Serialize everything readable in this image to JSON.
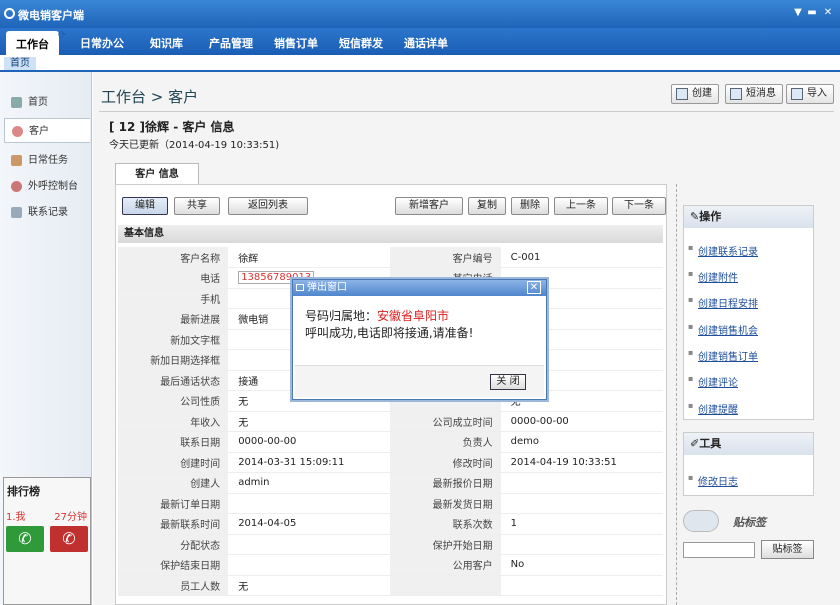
{
  "app": {
    "title": "微电销客户端"
  },
  "menu": {
    "items": [
      "工作台",
      "日常办公",
      "知识库",
      "产品管理",
      "销售订单",
      "短信群发",
      "通话详单"
    ]
  },
  "crumb": {
    "home": "首页"
  },
  "sidebar": {
    "items": [
      "首页",
      "客户",
      "日常任务",
      "外呼控制台",
      "联系记录"
    ]
  },
  "rank": {
    "title": "排行榜",
    "name": "1.我",
    "value": "27分钟"
  },
  "page": {
    "title": "工作台  > 客户",
    "record_title": "[ 12 ]徐辉  - 客户  信息",
    "updated": "今天已更新（2014-04-19 10:33:51)",
    "tab": "客户  信息",
    "section": "基本信息"
  },
  "toolbar": {
    "create": "创建",
    "sms": "短消息",
    "import": "导入"
  },
  "actions": [
    "编辑",
    "共享",
    "返回列表",
    "新增客户",
    "复制",
    "删除",
    "上一条",
    "下一条"
  ],
  "fields": [
    [
      "客户名称",
      "徐辉",
      "客户编号",
      "C-001"
    ],
    [
      "电话",
      "13856789013",
      "其它电话",
      ""
    ],
    [
      "手机",
      "",
      "",
      ""
    ],
    [
      "最新进展",
      "微电销",
      "",
      ""
    ],
    [
      "新加文字框",
      "",
      "",
      ""
    ],
    [
      "新加日期选择框",
      "",
      "",
      ""
    ],
    [
      "最后通话状态",
      "接通",
      "",
      ""
    ],
    [
      "公司性质",
      "无",
      "",
      "无"
    ],
    [
      "年收入",
      "无",
      "公司成立时间",
      "0000-00-00"
    ],
    [
      "联系日期",
      "0000-00-00",
      "负责人",
      "demo"
    ],
    [
      "创建时间",
      "2014-03-31 15:09:11",
      "修改时间",
      "2014-04-19 10:33:51"
    ],
    [
      "创建人",
      "admin",
      "最新报价日期",
      ""
    ],
    [
      "最新订单日期",
      "",
      "最新发货日期",
      ""
    ],
    [
      "最新联系时间",
      "2014-04-05",
      "联系次数",
      "1"
    ],
    [
      "分配状态",
      "",
      "保护开始日期",
      ""
    ],
    [
      "保护结束日期",
      "",
      "公用客户",
      "No"
    ],
    [
      "员工人数",
      "无",
      "",
      ""
    ]
  ],
  "ops": {
    "title": "操作",
    "links": [
      "创建联系记录",
      "创建附件",
      "创建日程安排",
      "创建销售机会",
      "创建销售订单",
      "创建评论",
      "创建提醒"
    ]
  },
  "tools": {
    "title": "工具",
    "links": [
      "修改日志"
    ]
  },
  "sticky": {
    "title": "贴标签",
    "button": "贴标签"
  },
  "popup": {
    "title": "弹出窗口",
    "line1_prefix": "号码归属地：",
    "line1_city": "安徽省阜阳市",
    "line2": "呼叫成功,电话即将接通,请准备!",
    "close": "关  闭"
  }
}
